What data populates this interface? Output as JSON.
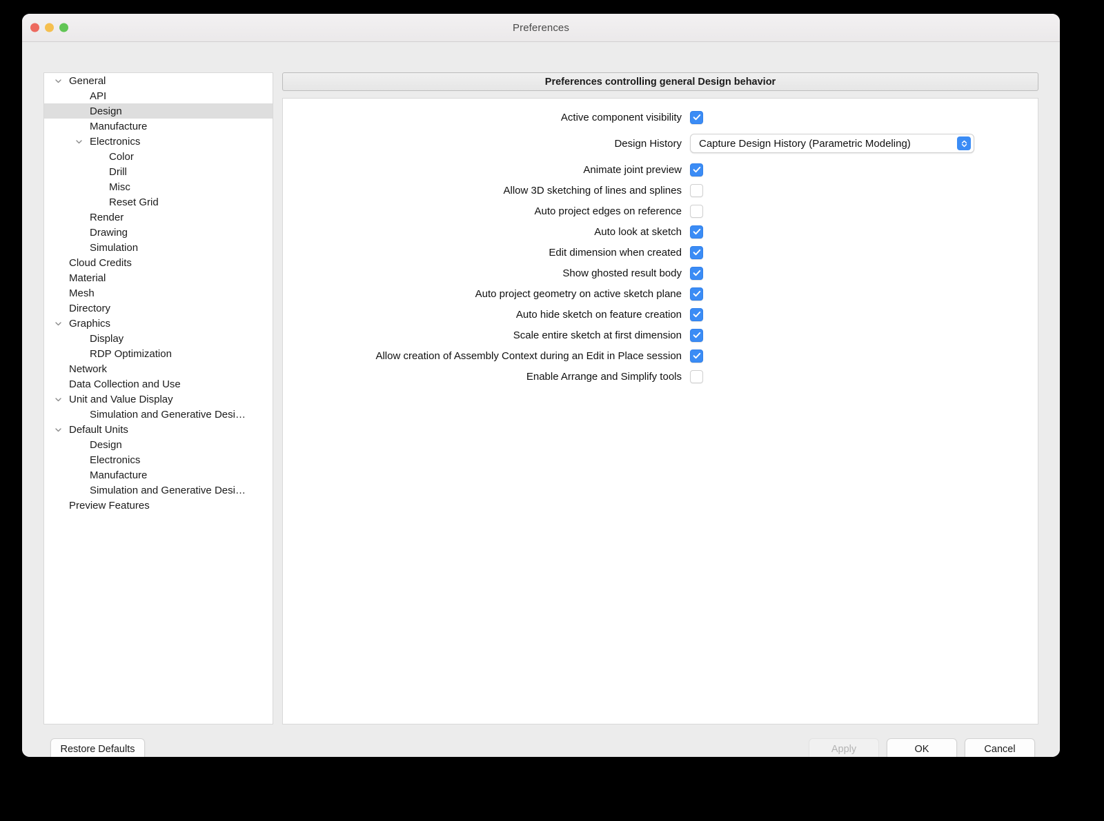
{
  "window": {
    "title": "Preferences",
    "traffic_lights": [
      "close",
      "minimize",
      "zoom"
    ]
  },
  "sidebar": {
    "items": [
      {
        "label": "General",
        "level": 0,
        "twisty": "down",
        "selected": false
      },
      {
        "label": "API",
        "level": 1,
        "twisty": "none",
        "selected": false
      },
      {
        "label": "Design",
        "level": 1,
        "twisty": "none",
        "selected": true
      },
      {
        "label": "Manufacture",
        "level": 1,
        "twisty": "none",
        "selected": false
      },
      {
        "label": "Electronics",
        "level": 1,
        "twisty": "down",
        "selected": false
      },
      {
        "label": "Color",
        "level": 2,
        "twisty": "none",
        "selected": false
      },
      {
        "label": "Drill",
        "level": 2,
        "twisty": "none",
        "selected": false
      },
      {
        "label": "Misc",
        "level": 2,
        "twisty": "none",
        "selected": false
      },
      {
        "label": "Reset Grid",
        "level": 2,
        "twisty": "none",
        "selected": false
      },
      {
        "label": "Render",
        "level": 1,
        "twisty": "none",
        "selected": false
      },
      {
        "label": "Drawing",
        "level": 1,
        "twisty": "none",
        "selected": false
      },
      {
        "label": "Simulation",
        "level": 1,
        "twisty": "none",
        "selected": false
      },
      {
        "label": "Cloud Credits",
        "level": 0,
        "twisty": "none",
        "selected": false
      },
      {
        "label": "Material",
        "level": 0,
        "twisty": "none",
        "selected": false
      },
      {
        "label": "Mesh",
        "level": 0,
        "twisty": "none",
        "selected": false
      },
      {
        "label": "Directory",
        "level": 0,
        "twisty": "none",
        "selected": false
      },
      {
        "label": "Graphics",
        "level": 0,
        "twisty": "down",
        "selected": false
      },
      {
        "label": "Display",
        "level": 1,
        "twisty": "none",
        "selected": false
      },
      {
        "label": "RDP Optimization",
        "level": 1,
        "twisty": "none",
        "selected": false
      },
      {
        "label": "Network",
        "level": 0,
        "twisty": "none",
        "selected": false
      },
      {
        "label": "Data Collection and Use",
        "level": 0,
        "twisty": "none",
        "selected": false
      },
      {
        "label": "Unit and Value Display",
        "level": 0,
        "twisty": "down",
        "selected": false
      },
      {
        "label": "Simulation and Generative Desi…",
        "level": 1,
        "twisty": "none",
        "selected": false
      },
      {
        "label": "Default Units",
        "level": 0,
        "twisty": "down",
        "selected": false
      },
      {
        "label": "Design",
        "level": 1,
        "twisty": "none",
        "selected": false
      },
      {
        "label": "Electronics",
        "level": 1,
        "twisty": "none",
        "selected": false
      },
      {
        "label": "Manufacture",
        "level": 1,
        "twisty": "none",
        "selected": false
      },
      {
        "label": "Simulation and Generative Desi…",
        "level": 1,
        "twisty": "none",
        "selected": false
      },
      {
        "label": "Preview Features",
        "level": 0,
        "twisty": "none",
        "selected": false
      }
    ]
  },
  "content": {
    "header": "Preferences controlling general Design behavior",
    "rows": [
      {
        "kind": "checkbox",
        "label": "Active component visibility",
        "checked": true
      },
      {
        "kind": "dropdown",
        "label": "Design History",
        "value": "Capture Design History (Parametric Modeling)"
      },
      {
        "kind": "checkbox",
        "label": "Animate joint preview",
        "checked": true
      },
      {
        "kind": "checkbox",
        "label": "Allow 3D sketching of lines and splines",
        "checked": false
      },
      {
        "kind": "checkbox",
        "label": "Auto project edges on reference",
        "checked": false
      },
      {
        "kind": "checkbox",
        "label": "Auto look at sketch",
        "checked": true
      },
      {
        "kind": "checkbox",
        "label": "Edit dimension when created",
        "checked": true
      },
      {
        "kind": "checkbox",
        "label": "Show ghosted result body",
        "checked": true
      },
      {
        "kind": "checkbox",
        "label": "Auto project geometry on active sketch plane",
        "checked": true
      },
      {
        "kind": "checkbox",
        "label": "Auto hide sketch on feature creation",
        "checked": true
      },
      {
        "kind": "checkbox",
        "label": "Scale entire sketch at first dimension",
        "checked": true
      },
      {
        "kind": "checkbox",
        "label": "Allow creation of Assembly Context during an Edit in Place session",
        "checked": true
      },
      {
        "kind": "checkbox",
        "label": "Enable Arrange and Simplify tools",
        "checked": false
      }
    ]
  },
  "footer": {
    "restore_label": "Restore Defaults",
    "apply_label": "Apply",
    "apply_enabled": false,
    "ok_label": "OK",
    "cancel_label": "Cancel"
  },
  "colors": {
    "accent": "#3b8cf5",
    "selected_row": "#dedede",
    "window_bg": "#ececec"
  }
}
